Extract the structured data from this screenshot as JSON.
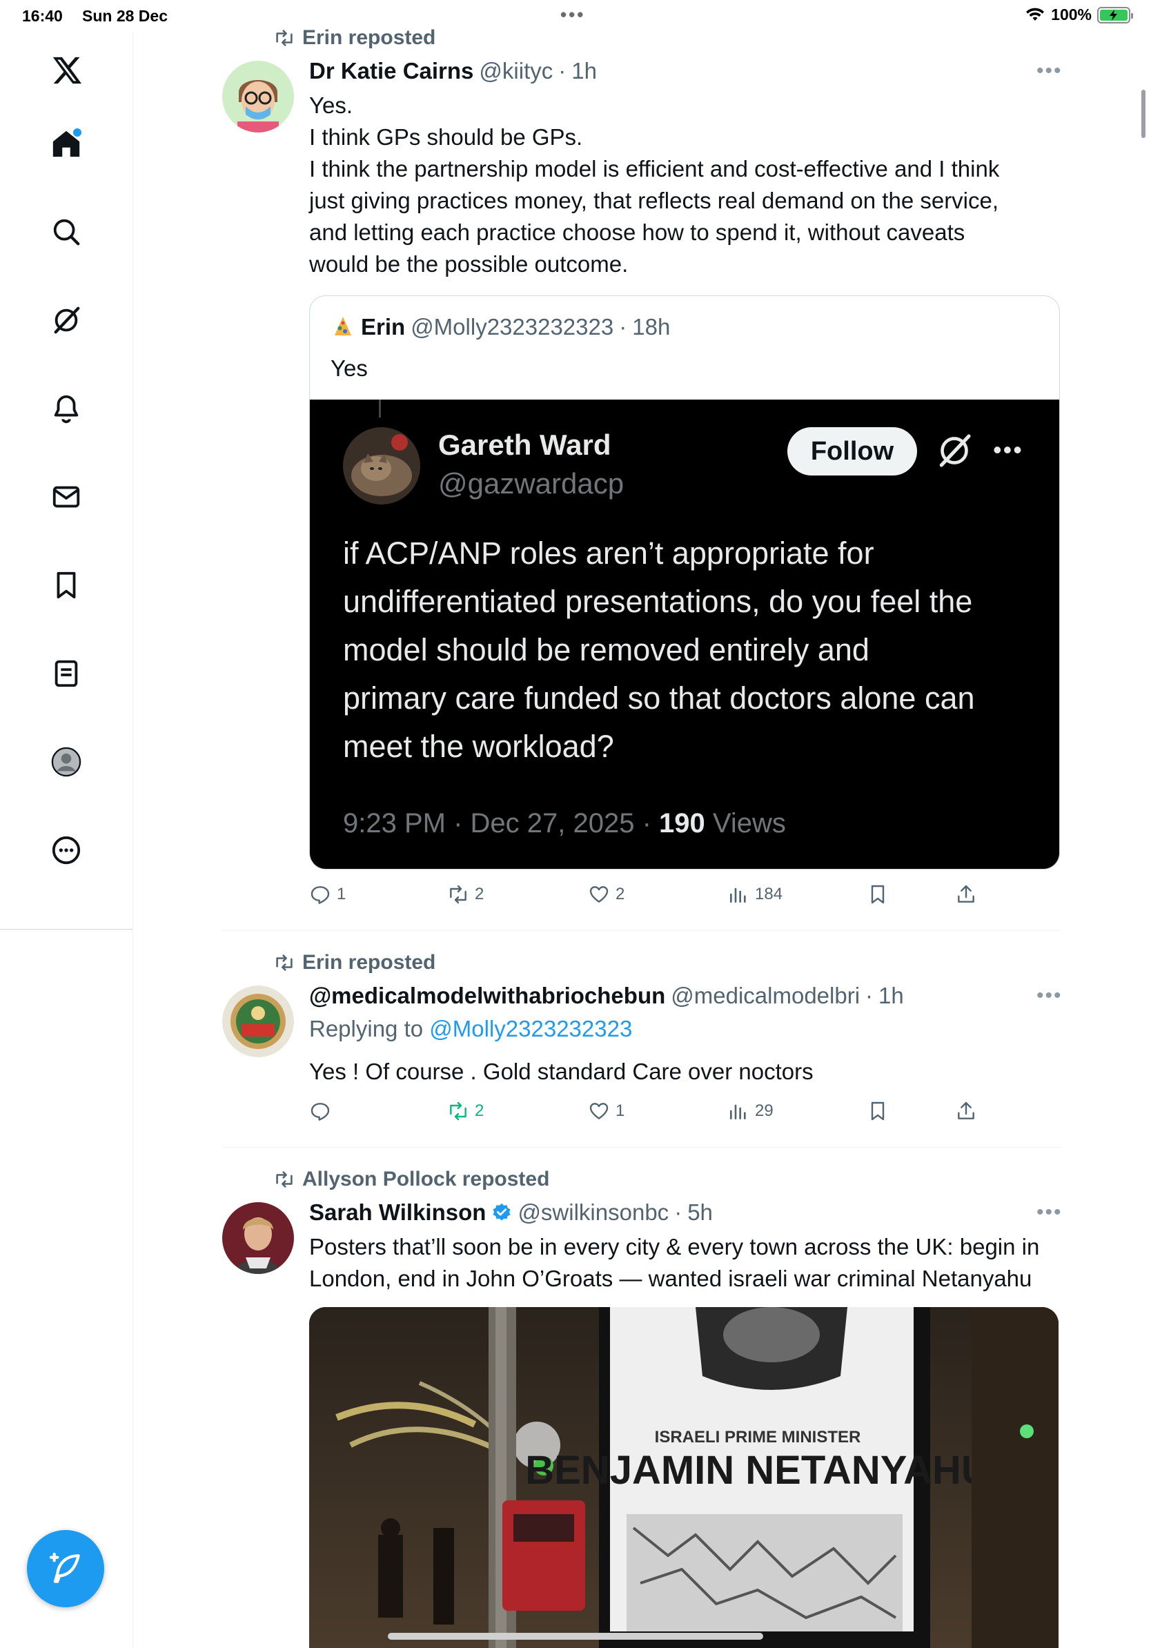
{
  "status_bar": {
    "time": "16:40",
    "date": "Sun 28 Dec",
    "battery": "100%",
    "battery_level": 1.0
  },
  "colors": {
    "accent": "#1d9bf0",
    "text_primary": "#0f1419",
    "text_secondary": "#536471",
    "repost_green": "#00ba7c"
  },
  "sidebar": {
    "items": [
      {
        "icon": "x-logo-icon"
      },
      {
        "icon": "home-icon",
        "active": true,
        "has_notification_dot": true
      },
      {
        "icon": "search-icon"
      },
      {
        "icon": "grok-icon"
      },
      {
        "icon": "notifications-bell-icon"
      },
      {
        "icon": "messages-envelope-icon"
      },
      {
        "icon": "bookmarks-icon"
      },
      {
        "icon": "lists-icon"
      },
      {
        "icon": "profile-avatar-icon"
      },
      {
        "icon": "more-circle-icon"
      }
    ],
    "compose": {
      "icon": "compose-feather-icon"
    }
  },
  "feed": {
    "posts": [
      {
        "repost_label": "Erin reposted",
        "author_name": "Dr Katie Cairns",
        "author_handle": "@kiityc",
        "time": "1h",
        "text_lines": [
          "Yes.",
          "I think GPs should be GPs.",
          "I think the partnership model is efficient and cost-effective and I think",
          "just giving practices money, that reflects real demand on the service,",
          "and letting each practice choose how to spend it, without caveats",
          "would be the possible outcome."
        ],
        "quote": {
          "author_name": "Erin",
          "author_handle": "@Molly2323232323",
          "time": "18h",
          "text": "Yes",
          "screenshot": {
            "name": "Gareth Ward",
            "handle": "@gazwardacp",
            "follow_label": "Follow",
            "text_lines": [
              "if ACP/ANP roles aren’t appropriate for",
              "undifferentiated presentations, do you feel the",
              "model should be removed entirely and",
              "primary care funded so that doctors alone can",
              "meet the workload?"
            ],
            "timestamp": "9:23 PM · Dec 27, 2025 ·",
            "views_count": "190",
            "views_label": "Views"
          }
        },
        "stats": {
          "replies": "1",
          "reposts": "2",
          "likes": "2",
          "views": "184"
        }
      },
      {
        "repost_label": "Erin reposted",
        "author_name": "@medicalmodelwithabriochebun",
        "author_handle": "@medicalmodelbri",
        "time": "1h",
        "reply_prefix": "Replying to",
        "reply_handle": "@Molly2323232323",
        "text": "Yes ! Of course . Gold standard Care over noctors",
        "stats": {
          "replies": "",
          "reposts": "2",
          "likes": "1",
          "views": "29"
        }
      },
      {
        "repost_label": "Allyson Pollock reposted",
        "author_name": "Sarah Wilkinson",
        "verified": true,
        "author_handle": "@swilkinsonbc",
        "time": "5h",
        "text_lines": [
          "Posters that’ll soon be in every city & every town across the UK: begin in",
          "London, end in John O’Groats — wanted israeli war criminal Netanyahu"
        ],
        "media": {
          "poster_line1": "ISRAELI PRIME MINISTER",
          "poster_line2": "BENJAMIN NETANYAHU"
        }
      }
    ]
  }
}
